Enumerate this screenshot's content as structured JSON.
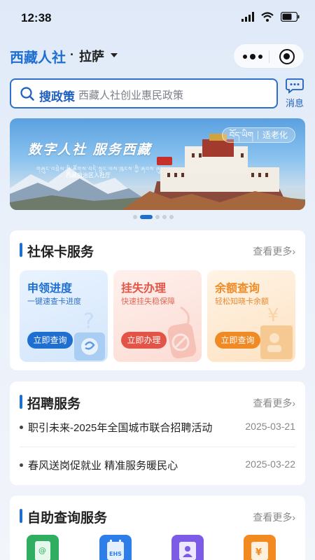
{
  "status": {
    "time": "12:38"
  },
  "header": {
    "app_title": "西藏人社",
    "separator": "·",
    "city": "拉萨"
  },
  "search": {
    "label": "搜政策",
    "placeholder": "西藏人社创业惠民政策"
  },
  "message": {
    "label": "消息"
  },
  "banner": {
    "title": "数字人社 服务西藏",
    "tag_tibetan": "བོད་ཡིག",
    "tag_label": "适老化",
    "script_line": "གཞུང་འབྲེལ་སྤྱི་ཚོགས་བདེ་སྲུང་ལས་ཁུངས་ཀྱི་ཞབས་ཞུ་",
    "sub_line": "西藏自治区人社厅"
  },
  "carousel": {
    "count": 5,
    "active_index": 1
  },
  "social_card": {
    "title": "社保卡服务",
    "more": "查看更多",
    "services": [
      {
        "title": "申领进度",
        "subtitle": "一键速查卡进度",
        "button": "立即查询",
        "color": "#1f6fd1"
      },
      {
        "title": "挂失办理",
        "subtitle": "快速挂失稳保障",
        "button": "立即办理",
        "color": "#e45446"
      },
      {
        "title": "余额查询",
        "subtitle": "轻松知晓卡余额",
        "button": "立即查询",
        "color": "#ef8a25"
      }
    ]
  },
  "recruit_card": {
    "title": "招聘服务",
    "more": "查看更多",
    "items": [
      {
        "title": "职引未来-2025年全国城市联合招聘活动",
        "date": "2025-03-21"
      },
      {
        "title": "春风送岗促就业 精准服务暖民心",
        "date": "2025-03-22"
      }
    ]
  },
  "self_card": {
    "title": "自助查询服务",
    "more": "查看更多",
    "icons": [
      {
        "name": "social-security-icon",
        "color": "#2fae62"
      },
      {
        "name": "calendar-ehs-icon",
        "color": "#2d7ee8"
      },
      {
        "name": "worker-icon",
        "color": "#7c5ce6"
      },
      {
        "name": "payment-icon",
        "color": "#f28a21"
      }
    ]
  }
}
